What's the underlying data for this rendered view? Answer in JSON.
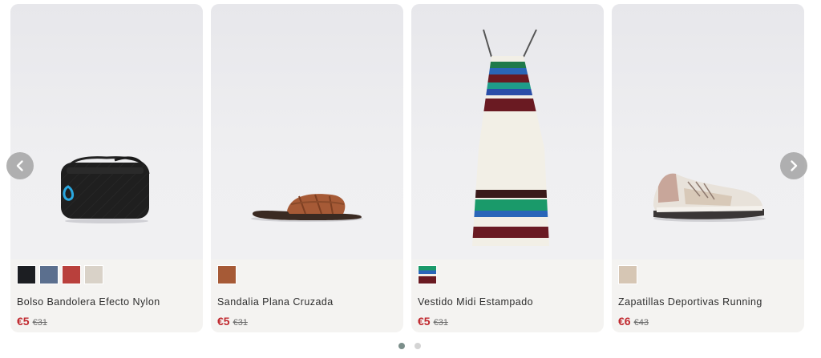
{
  "carousel": {
    "products": [
      {
        "name": "Bolso Bandolera Efecto Nylon",
        "price": "€5",
        "old_price": "€31",
        "swatches": [
          "#1c1e22",
          "#5b6f8e",
          "#b9403c",
          "#d9d2c8"
        ],
        "image": "black-crossbody-bag"
      },
      {
        "name": "Sandalia Plana Cruzada",
        "price": "€5",
        "old_price": "€31",
        "swatches": [
          "#a65a36"
        ],
        "image": "brown-flat-sandal"
      },
      {
        "name": "Vestido Midi Estampado",
        "price": "€5",
        "old_price": "€31",
        "swatches": [
          "pattern"
        ],
        "image": "striped-midi-dress"
      },
      {
        "name": "Zapatillas Deportivas Running",
        "price": "€6",
        "old_price": "€43",
        "swatches": [
          "#d6c6b4"
        ],
        "image": "running-sneaker"
      }
    ],
    "prev_icon": "chevron-left-icon",
    "next_icon": "chevron-right-icon",
    "pages": 2,
    "active_page": 1
  }
}
